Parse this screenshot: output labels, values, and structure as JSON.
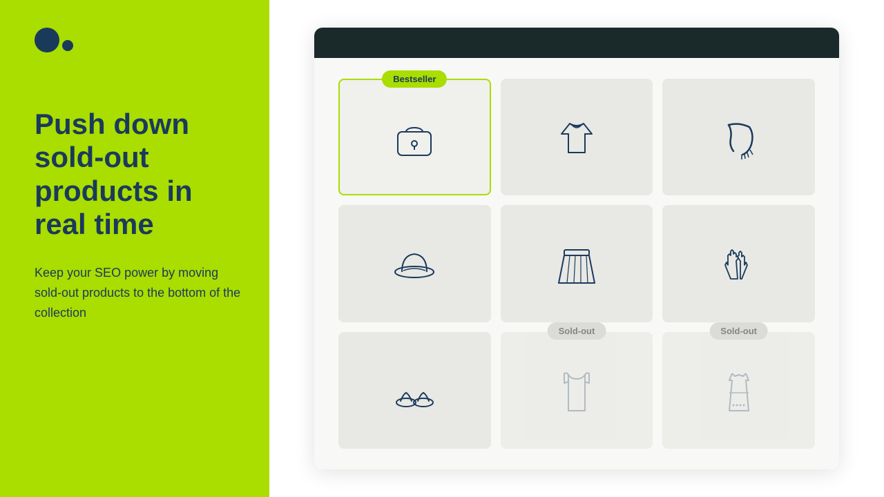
{
  "leftPanel": {
    "headline": "Push down sold-out products in real time",
    "subtext": "Keep your SEO power by moving sold-out products to the bottom of the collection",
    "logo": "dots-logo"
  },
  "rightPanel": {
    "browserBar": "",
    "grid": {
      "items": [
        {
          "id": 1,
          "type": "featured",
          "badge": "Bestseller",
          "badgeType": "bestseller",
          "icon": "handbag"
        },
        {
          "id": 2,
          "type": "normal",
          "badge": "",
          "badgeType": "",
          "icon": "top"
        },
        {
          "id": 3,
          "type": "normal",
          "badge": "",
          "badgeType": "",
          "icon": "scarf"
        },
        {
          "id": 4,
          "type": "normal",
          "badge": "",
          "badgeType": "",
          "icon": "hat"
        },
        {
          "id": 5,
          "type": "normal",
          "badge": "",
          "badgeType": "",
          "icon": "skirt"
        },
        {
          "id": 6,
          "type": "normal",
          "badge": "",
          "badgeType": "",
          "icon": "gloves"
        },
        {
          "id": 7,
          "type": "normal",
          "badge": "",
          "badgeType": "",
          "icon": "sandals"
        },
        {
          "id": 8,
          "type": "soldout",
          "badge": "Sold-out",
          "badgeType": "soldout",
          "icon": "tanktop"
        },
        {
          "id": 9,
          "type": "soldout",
          "badge": "Sold-out",
          "badgeType": "soldout",
          "icon": "dress"
        }
      ]
    }
  },
  "badges": {
    "bestseller": "Bestseller",
    "soldout": "Sold-out"
  }
}
